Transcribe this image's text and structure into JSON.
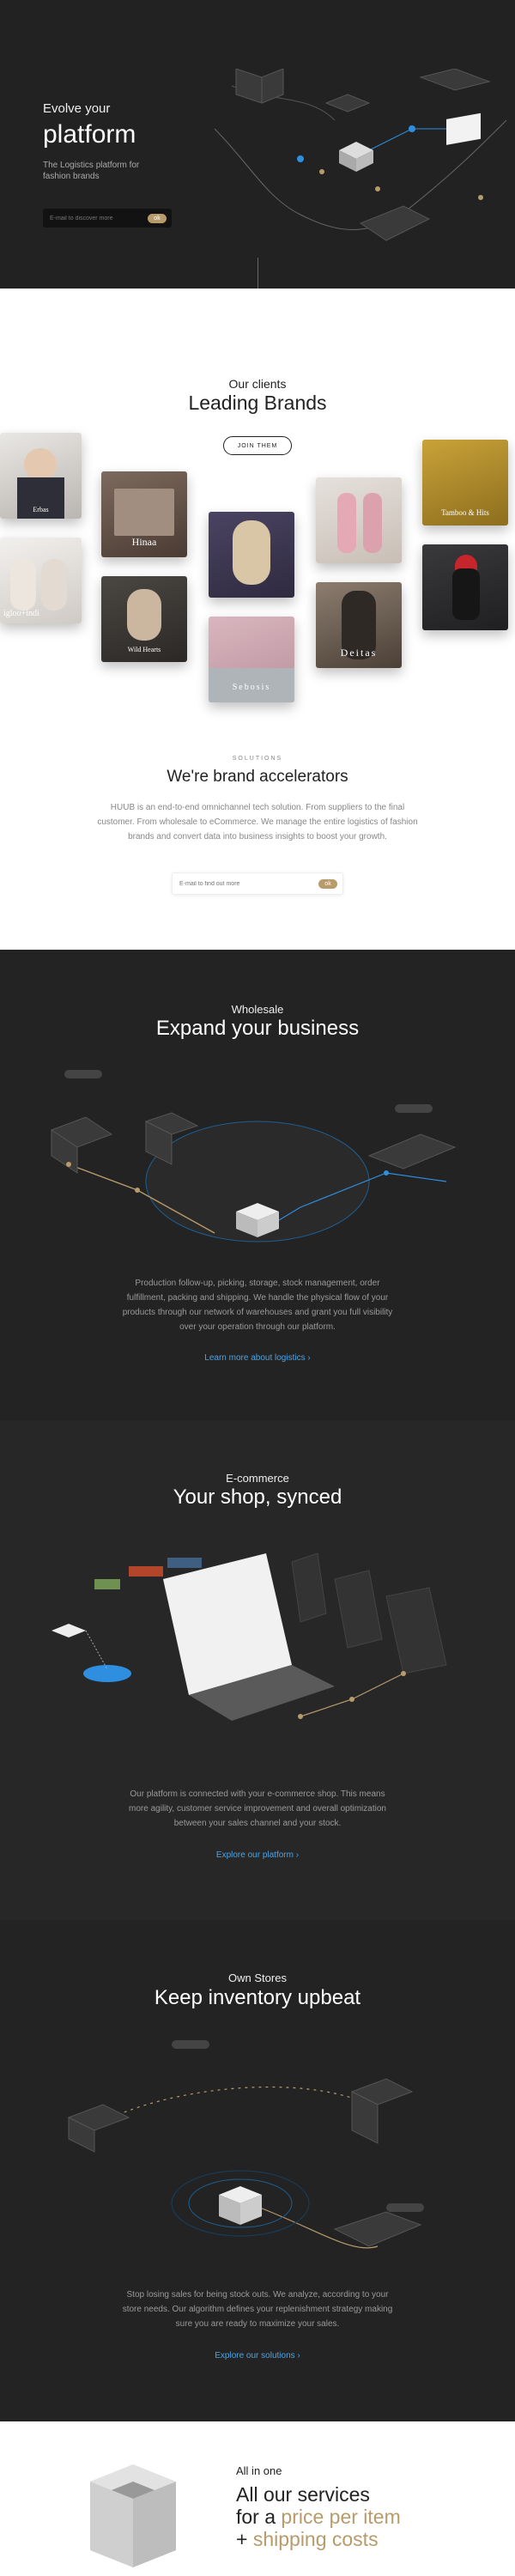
{
  "hero": {
    "small_title": "Evolve your",
    "big_title": "platform",
    "subtitle": "The Logistics platform for fashion brands",
    "email_placeholder": "E-mail to discover more",
    "button_label": "ok"
  },
  "clients": {
    "eyebrow": "Our clients",
    "title": "Leading Brands",
    "button_label": "JOIN THEM",
    "brands": [
      "Hinaa",
      "Wild Hearts",
      "Deitas",
      "Sebosis",
      "Tamboo & Hits",
      "igloo+indi",
      "Erbas"
    ]
  },
  "solutions": {
    "tag": "SOLUTIONS",
    "title": "We're brand accelerators",
    "text": "HUUB is an end-to-end omnichannel tech solution. From suppliers to the final customer. From wholesale to eCommerce. We manage the entire logistics of fashion brands and convert data into business insights to boost your growth.",
    "email_placeholder": "E-mail to find out more",
    "button_label": "ok"
  },
  "wholesale": {
    "subtitle": "Wholesale",
    "title": "Expand your business",
    "text": "Production follow-up, picking, storage, stock management, order fulfillment, packing and shipping. We handle the physical flow of your products through our network of warehouses and grant you full visibility over your operation through our platform.",
    "link": "Learn more about logistics  ›"
  },
  "ecommerce": {
    "subtitle": "E-commerce",
    "title": "Your shop, synced",
    "text": "Our platform is connected with your e-commerce shop. This means more agility, customer service improvement and overall optimization between your sales channel and your stock.",
    "link": "Explore our platform  ›"
  },
  "stores": {
    "subtitle": "Own Stores",
    "title": "Keep inventory upbeat",
    "text": "Stop losing sales for being stock outs. We analyze, according to your store needs. Our algorithm defines your replenishment strategy making sure you are ready to maximize your sales.",
    "link": "Explore our solutions  ›"
  },
  "allinone": {
    "small": "All in one",
    "line1": "All our services",
    "line2_prefix": "for a ",
    "line2_gold": "price per item",
    "line3_prefix": "+ ",
    "line3_gold": "shipping costs"
  },
  "colors": {
    "gold": "#b79b6b",
    "link_blue": "#4ea3e0",
    "dark_bg": "#232323"
  }
}
